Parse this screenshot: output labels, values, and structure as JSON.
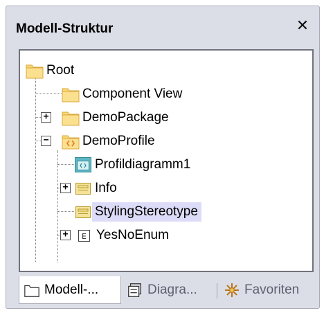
{
  "panel": {
    "title": "Modell-Struktur",
    "close_glyph": "✕"
  },
  "tree": {
    "root": "Root",
    "component_view": "Component View",
    "demo_package": "DemoPackage",
    "demo_profile": "DemoProfile",
    "profildiagramm": "Profildiagramm1",
    "info": "Info",
    "styling_stereotype": "StylingStereotype",
    "yes_no_enum": "YesNoEnum",
    "expand_glyph": "+",
    "collapse_glyph": "−",
    "enum_glyph": "E"
  },
  "tabs": [
    {
      "label": "Modell-...",
      "icon": "folder-icon",
      "active": true
    },
    {
      "label": "Diagra...",
      "icon": "diagram-tree-icon",
      "active": false
    },
    {
      "label": "Favoriten",
      "icon": "favorites-star-icon",
      "active": false
    }
  ],
  "colors": {
    "folder": "#f8d774",
    "folder_edge": "#d9a83b",
    "selection": "#dcdcf8",
    "panel_bg": "#dcdee7",
    "profile_accent": "#e07b1a",
    "stereotype_icon": "#e9d27a"
  }
}
